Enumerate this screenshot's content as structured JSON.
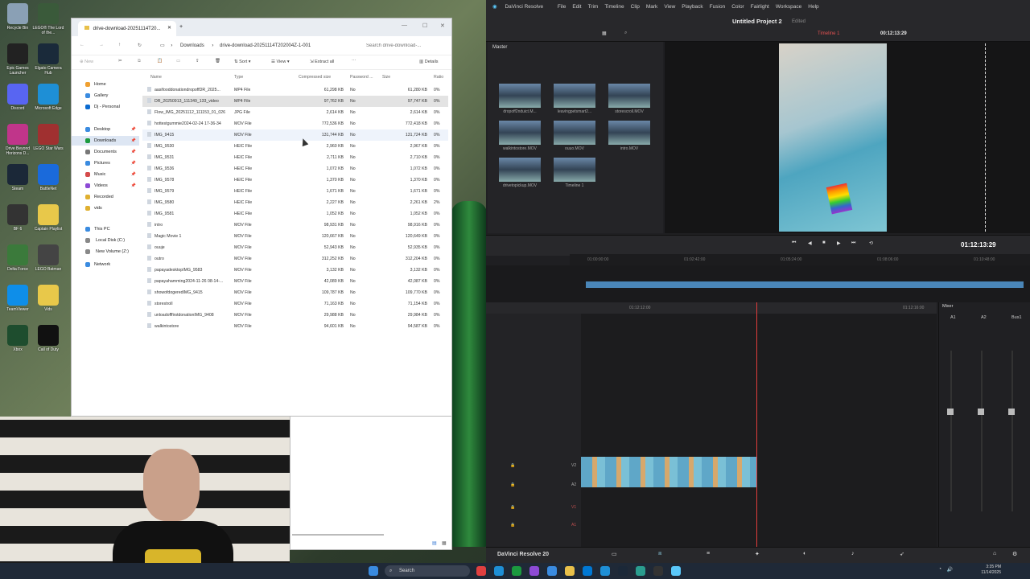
{
  "desktop": {
    "icons": [
      {
        "label": "Recycle Bin",
        "color": "#8aa0b5"
      },
      {
        "label": "LEGO® The Lord of the...",
        "color": "#3a5a3a"
      },
      {
        "label": "Epic Games Launcher",
        "color": "#222"
      },
      {
        "label": "Elgato Camera Hub",
        "color": "#1a2a3a"
      },
      {
        "label": "Discord",
        "color": "#5865f2"
      },
      {
        "label": "Microsoft Edge",
        "color": "#1e8fd6"
      },
      {
        "label": "Drive Beyond Horizons D...",
        "color": "#c0358a"
      },
      {
        "label": "LEGO Star Wars",
        "color": "#a03030"
      },
      {
        "label": "Steam",
        "color": "#1b2838"
      },
      {
        "label": "BattleNet",
        "color": "#1a6adb"
      },
      {
        "label": "BF 6",
        "color": "#333"
      },
      {
        "label": "Captain Playlist",
        "color": "#e8c84a"
      },
      {
        "label": "Delta Force",
        "color": "#3b7a3b"
      },
      {
        "label": "LEGO Batman",
        "color": "#444"
      },
      {
        "label": "TeamViewer",
        "color": "#0e8ee9"
      },
      {
        "label": "Vids",
        "color": "#e8c84a"
      },
      {
        "label": "Xbox",
        "color": "#1e4d2e"
      },
      {
        "label": "Call of Duty",
        "color": "#111"
      }
    ]
  },
  "explorer": {
    "tab_title": "drive-download-20251114T20...",
    "address": [
      "Downloads",
      "drive-download-20251114T202004Z-1-001"
    ],
    "search_placeholder": "Search drive-download-...",
    "toolbar": {
      "new": "New",
      "sort": "Sort",
      "view": "View",
      "extract": "Extract all",
      "details": "Details"
    },
    "nav": [
      {
        "label": "Home",
        "color": "#f0a030"
      },
      {
        "label": "Gallery",
        "color": "#3a8be0"
      },
      {
        "label": "Dj - Personal",
        "color": "#0b6bd0"
      },
      {
        "label": "Desktop",
        "color": "#3a8be0",
        "pin": "📌"
      },
      {
        "label": "Downloads",
        "color": "#1b9a3f",
        "pin": "📌",
        "selected": true
      },
      {
        "label": "Documents",
        "color": "#777",
        "pin": "📌"
      },
      {
        "label": "Pictures",
        "color": "#3a8be0",
        "pin": "📌"
      },
      {
        "label": "Music",
        "color": "#d54b4b",
        "pin": "📌"
      },
      {
        "label": "Videos",
        "color": "#8d4ad5",
        "pin": "📌"
      },
      {
        "label": "Recorded",
        "color": "#e0b030"
      },
      {
        "label": "vids",
        "color": "#e0b030"
      },
      {
        "label": "This PC",
        "color": "#3a8be0"
      },
      {
        "label": "Local Disk (C:)",
        "color": "#888"
      },
      {
        "label": "New Volume (Z:)",
        "color": "#888"
      },
      {
        "label": "Network",
        "color": "#3a8be0"
      }
    ],
    "columns": [
      "Name",
      "Type",
      "Compressed size",
      "Password ...",
      "Size",
      "Ratio"
    ],
    "files": [
      [
        "aasifooddonationdropoffDR_2025...",
        "MP4 File",
        "61,298 KB",
        "No",
        "61,280 KB",
        "0%"
      ],
      [
        "DR_20250913_111349_133_video",
        "MP4 File",
        "97,762 KB",
        "No",
        "97,747 KB",
        "0%"
      ],
      [
        "Flow_IMG_20251112_111153_01_026",
        "JPG File",
        "2,614 KB",
        "No",
        "2,614 KB",
        "0%"
      ],
      [
        "hottestgummie2024-02-24 17-36-34",
        "MOV File",
        "772,536 KB",
        "No",
        "772,418 KB",
        "0%"
      ],
      [
        "IMG_9415",
        "MOV File",
        "131,744 KB",
        "No",
        "131,724 KB",
        "0%"
      ],
      [
        "IMG_9530",
        "HEIC File",
        "2,960 KB",
        "No",
        "2,967 KB",
        "0%"
      ],
      [
        "IMG_9531",
        "HEIC File",
        "2,711 KB",
        "No",
        "2,710 KB",
        "0%"
      ],
      [
        "IMG_9536",
        "HEIC File",
        "1,072 KB",
        "No",
        "1,072 KB",
        "0%"
      ],
      [
        "IMG_9578",
        "HEIC File",
        "1,370 KB",
        "No",
        "1,370 KB",
        "0%"
      ],
      [
        "IMG_9579",
        "HEIC File",
        "1,671 KB",
        "No",
        "1,671 KB",
        "0%"
      ],
      [
        "IMG_9580",
        "HEIC File",
        "2,227 KB",
        "No",
        "2,261 KB",
        "2%"
      ],
      [
        "IMG_9581",
        "HEIC File",
        "1,052 KB",
        "No",
        "1,052 KB",
        "0%"
      ],
      [
        "intro",
        "MOV File",
        "98,931 KB",
        "No",
        "98,916 KB",
        "0%"
      ],
      [
        "Magic Movie 1",
        "MOV File",
        "120,667 KB",
        "No",
        "120,649 KB",
        "0%"
      ],
      [
        "ouuje",
        "MOV File",
        "52,943 KB",
        "No",
        "52,935 KB",
        "0%"
      ],
      [
        "outro",
        "MOV File",
        "312,252 KB",
        "No",
        "312,204 KB",
        "0%"
      ],
      [
        "papayadesktopIMG_9583",
        "MOV File",
        "3,132 KB",
        "No",
        "3,132 KB",
        "0%"
      ],
      [
        "papayahamming2024-11-26 08-14-...",
        "MOV File",
        "42,089 KB",
        "No",
        "42,087 KB",
        "0%"
      ],
      [
        "showofdogeredIMG_9415",
        "MOV File",
        "109,787 KB",
        "No",
        "109,770 KB",
        "0%"
      ],
      [
        "storestroll",
        "MOV File",
        "71,163 KB",
        "No",
        "71,154 KB",
        "0%"
      ],
      [
        "unloadofffirstdonationIMG_9408",
        "MOV File",
        "29,988 KB",
        "No",
        "29,984 KB",
        "0%"
      ],
      [
        "walkintostore",
        "MOV File",
        "94,601 KB",
        "No",
        "94,587 KB",
        "0%"
      ]
    ]
  },
  "resolve": {
    "app": "DaVinci Resolve",
    "menu": [
      "File",
      "Edit",
      "Trim",
      "Timeline",
      "Clip",
      "Mark",
      "View",
      "Playback",
      "Fusion",
      "Color",
      "Fairlight",
      "Workspace",
      "Help"
    ],
    "project": "Untitled Project 2",
    "edited": "Edited",
    "timeline_name": "Timeline 1",
    "timecode_top": "00:12:13:29",
    "bin": "Master",
    "clips": [
      "dropoff2nduict.M...",
      "leavingpetsmart2...",
      "storescroll.MOV",
      "walkintostore.MOV",
      "ouuo.MOV",
      "intro.MOV",
      "drivetopickup.MOV",
      "Timeline 1"
    ],
    "timecode_main": "01:12:13:29",
    "ruler": [
      "01:00:00:00",
      "01:02:42:00",
      "01:05:24:00",
      "01:08:06:00",
      "01:10:48:00"
    ],
    "lower_ruler": [
      "01:12:12:00",
      "01:12:16:00"
    ],
    "tracks": [
      "V2",
      "A2",
      "V1",
      "A1"
    ],
    "mixer": {
      "title": "Mixer",
      "channels": [
        "A1",
        "A2",
        "Bus1"
      ]
    },
    "footer": "DaVinci Resolve 20"
  },
  "taskbar": {
    "search": "Search",
    "time": "3:35 PM",
    "date": "11/14/2025"
  }
}
